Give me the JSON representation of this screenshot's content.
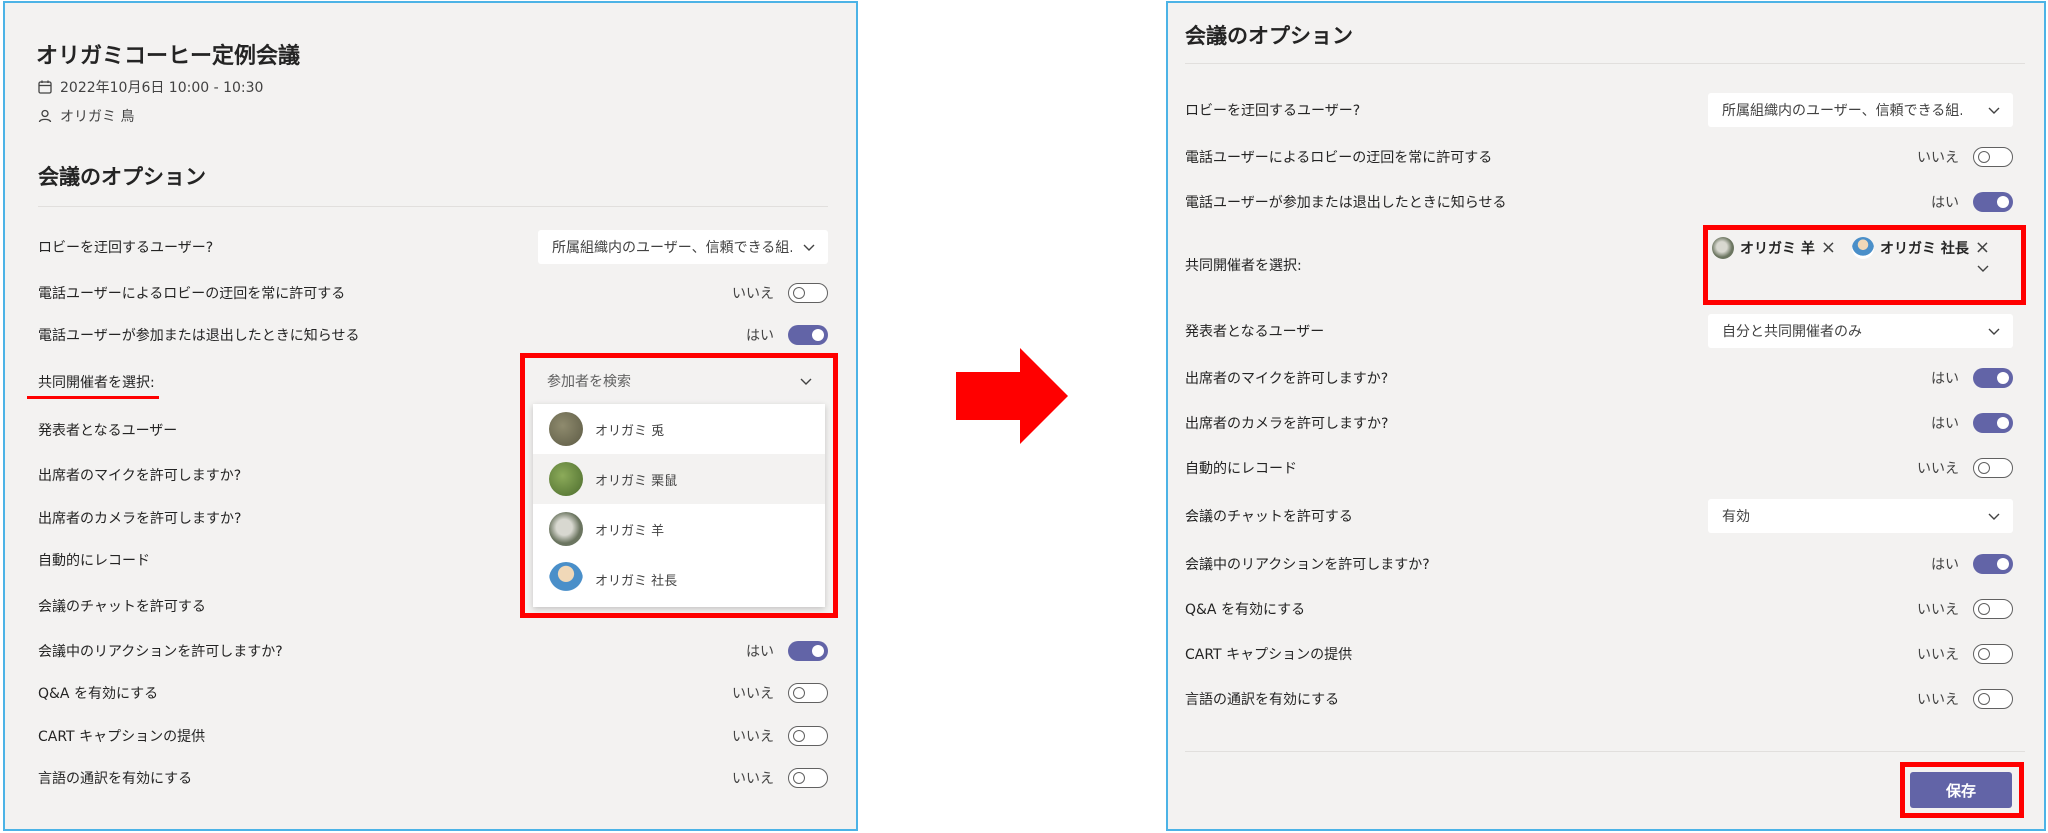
{
  "left": {
    "meeting_title": "オリガミコーヒー定例会議",
    "date": "2022年10月6日 10:00 - 10:30",
    "organizer": "オリガミ 鳥",
    "section_title": "会議のオプション",
    "rows": {
      "bypass_lobby": {
        "label": "ロビーを迂回するユーザー?",
        "value": "所属組織内のユーザー、信頼できる組..."
      },
      "phone_bypass": {
        "label": "電話ユーザーによるロビーの迂回を常に許可する",
        "state": "いいえ"
      },
      "phone_announce": {
        "label": "電話ユーザーが参加または退出したときに知らせる",
        "state": "はい"
      },
      "co_organizers": {
        "label": "共同開催者を選択:"
      },
      "presenters": {
        "label": "発表者となるユーザー"
      },
      "mic": {
        "label": "出席者のマイクを許可しますか?"
      },
      "camera": {
        "label": "出席者のカメラを許可しますか?"
      },
      "record": {
        "label": "自動的にレコード"
      },
      "chat": {
        "label": "会議のチャットを許可する"
      },
      "reactions": {
        "label": "会議中のリアクションを許可しますか?",
        "state": "はい"
      },
      "qa": {
        "label": "Q&A を有効にする",
        "state": "いいえ"
      },
      "cart": {
        "label": "CART キャプションの提供",
        "state": "いいえ"
      },
      "interp": {
        "label": "言語の通訳を有効にする",
        "state": "いいえ"
      }
    },
    "dropdown": {
      "placeholder": "参加者を検索",
      "options": [
        "オリガミ 兎",
        "オリガミ 栗鼠",
        "オリガミ 羊",
        "オリガミ 社長"
      ]
    }
  },
  "right": {
    "section_title": "会議のオプション",
    "rows": {
      "bypass_lobby": {
        "label": "ロビーを迂回するユーザー?",
        "value": "所属組織内のユーザー、信頼できる組..."
      },
      "phone_bypass": {
        "label": "電話ユーザーによるロビーの迂回を常に許可する",
        "state": "いいえ"
      },
      "phone_announce": {
        "label": "電話ユーザーが参加または退出したときに知らせる",
        "state": "はい"
      },
      "co_organizers": {
        "label": "共同開催者を選択:",
        "chips": [
          "オリガミ 羊",
          "オリガミ 社長"
        ]
      },
      "presenters": {
        "label": "発表者となるユーザー",
        "value": "自分と共同開催者のみ"
      },
      "mic": {
        "label": "出席者のマイクを許可しますか?",
        "state": "はい"
      },
      "camera": {
        "label": "出席者のカメラを許可しますか?",
        "state": "はい"
      },
      "record": {
        "label": "自動的にレコード",
        "state": "いいえ"
      },
      "chat": {
        "label": "会議のチャットを許可する",
        "value": "有効"
      },
      "reactions": {
        "label": "会議中のリアクションを許可しますか?",
        "state": "はい"
      },
      "qa": {
        "label": "Q&A を有効にする",
        "state": "いいえ"
      },
      "cart": {
        "label": "CART キャプションの提供",
        "state": "いいえ"
      },
      "interp": {
        "label": "言語の通訳を有効にする",
        "state": "いいえ"
      }
    },
    "save_label": "保存"
  },
  "colors": {
    "accent": "#6264a7",
    "highlight": "#ff0000",
    "panel_bg": "#f3f2f1",
    "panel_border": "#4cb3e6"
  },
  "icons": {
    "date": "calendar-icon",
    "organizer": "person-icon",
    "transition": "arrow-right-icon"
  }
}
